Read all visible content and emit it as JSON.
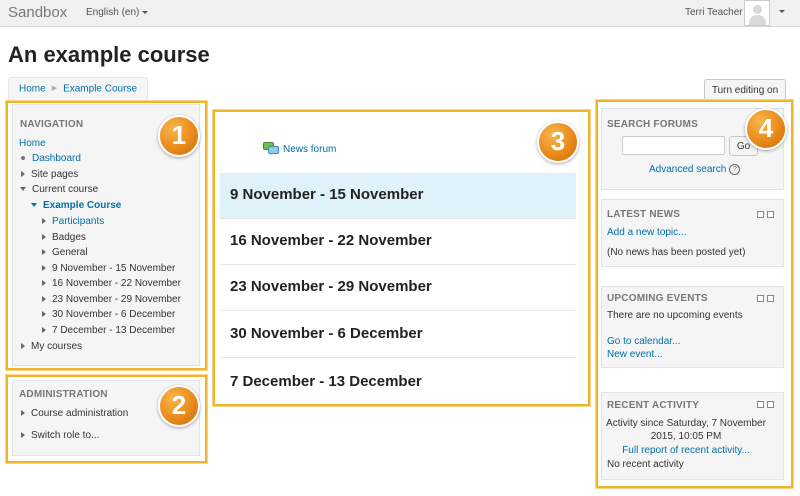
{
  "header": {
    "brand": "Sandbox",
    "language": "English (en)",
    "user_name": "Terri Teacher"
  },
  "page": {
    "title": "An example course",
    "breadcrumb": [
      "Home",
      "Example Course"
    ],
    "edit_button": "Turn editing on"
  },
  "markers": [
    "1",
    "2",
    "3",
    "4"
  ],
  "navigation": {
    "title": "NAVIGATION",
    "home": "Home",
    "dashboard": "Dashboard",
    "site_pages": "Site pages",
    "current_course": "Current course",
    "course": "Example Course",
    "participants": "Participants",
    "badges": "Badges",
    "general": "General",
    "weeks": [
      "9 November - 15 November",
      "16 November - 22 November",
      "23 November - 29 November",
      "30 November - 6 December",
      "7 December - 13 December"
    ],
    "my_courses": "My courses"
  },
  "administration": {
    "title": "ADMINISTRATION",
    "course_admin": "Course administration",
    "switch_role": "Switch role to..."
  },
  "main": {
    "news_forum": "News forum",
    "sections": [
      "9 November - 15 November",
      "16 November - 22 November",
      "23 November - 29 November",
      "30 November - 6 December",
      "7 December - 13 December"
    ]
  },
  "search_forums": {
    "title": "SEARCH FORUMS",
    "go": "Go",
    "advanced": "Advanced search"
  },
  "latest_news": {
    "title": "LATEST NEWS",
    "add_topic": "Add a new topic...",
    "empty": "(No news has been posted yet)"
  },
  "upcoming_events": {
    "title": "UPCOMING EVENTS",
    "empty": "There are no upcoming events",
    "calendar": "Go to calendar...",
    "new_event": "New event..."
  },
  "recent_activity": {
    "title": "RECENT ACTIVITY",
    "since_line1": "Activity since Saturday, 7 November",
    "since_line2": "2015, 10:05 PM",
    "full_report": "Full report of recent activity...",
    "empty": "No recent activity"
  }
}
